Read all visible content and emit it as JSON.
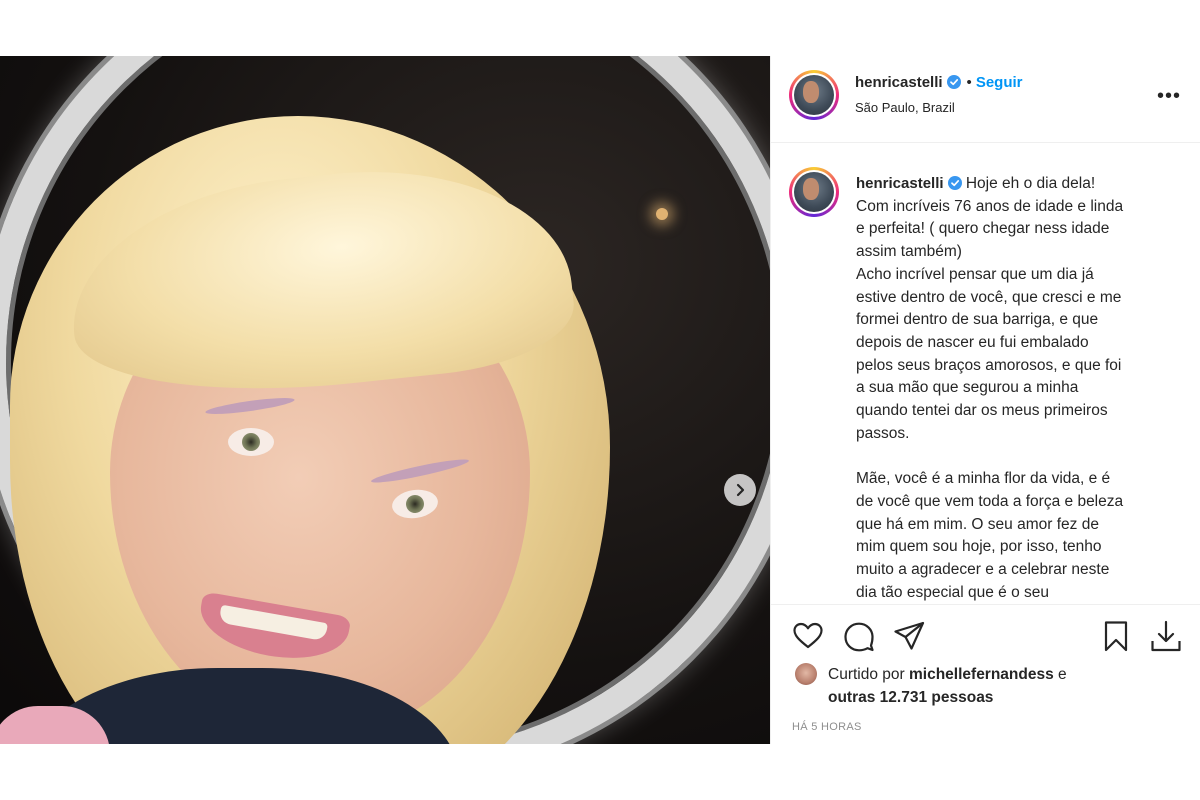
{
  "post": {
    "username": "henricastelli",
    "verified": true,
    "follow_label": "Seguir",
    "separator": "•",
    "location": "São Paulo, Brazil",
    "more_label": "•••"
  },
  "caption": {
    "username": "henricastelli",
    "lines": [
      "Hoje eh o dia dela!",
      "Com incríveis 76 anos de idade e linda",
      "e perfeita! ( quero chegar ness idade",
      "assim também)",
      "Acho incrível pensar que um dia já",
      "estive dentro de você, que cresci e me",
      "formei dentro de sua barriga, e que",
      "depois de nascer eu fui embalado",
      "pelos seus braços amorosos, e que foi",
      "a sua mão que segurou a minha",
      "quando tentei dar os meus primeiros",
      "passos.",
      "",
      "Mãe, você é a minha flor da vida, e é",
      "de você que vem toda a força e beleza",
      "que há em mim. O seu amor fez de",
      "mim quem sou hoje, por isso, tenho",
      "muito a agradecer e a celebrar neste",
      "dia tão especial que é o seu"
    ]
  },
  "likes": {
    "prefix": "Curtido por",
    "liked_by": "michellefernandess",
    "connector": "e",
    "others": "outras 12.731 pessoas"
  },
  "timestamp": "HÁ 5 HORAS",
  "icons": {
    "like": "heart-icon",
    "comment": "comment-icon",
    "share": "send-icon",
    "save": "bookmark-icon",
    "download": "download-icon",
    "next": "chevron-right-icon",
    "verified": "verified-badge-icon"
  },
  "colors": {
    "follow": "#0095f6",
    "verified": "#3897f0",
    "text": "#262626",
    "muted": "#8e8e8e",
    "divider": "#efefef"
  }
}
